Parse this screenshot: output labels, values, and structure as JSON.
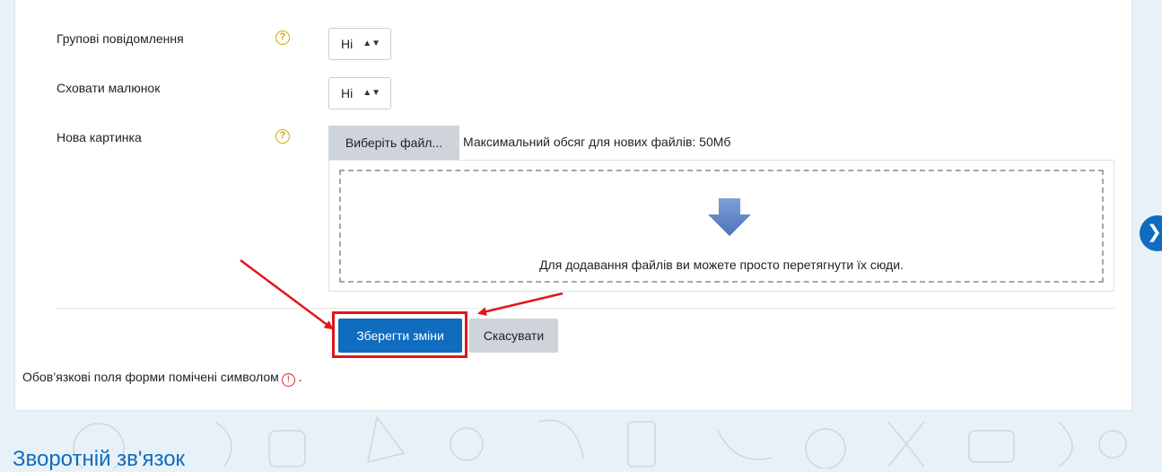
{
  "form": {
    "rows": [
      {
        "label": "Групові повідомлення",
        "value": "Ні",
        "has_help": true
      },
      {
        "label": "Сховати малюнок",
        "value": "Ні",
        "has_help": false
      },
      {
        "label": "Нова картинка",
        "has_help": true
      }
    ],
    "file_picker": {
      "button_label": "Виберіть файл...",
      "max_size_text": "Максимальний обсяг для нових файлів: 50Мб",
      "drop_text": "Для додавання файлів ви можете просто перетягнути їх сюди."
    },
    "buttons": {
      "save": "Зберегти зміни",
      "cancel": "Скасувати"
    },
    "required_note": "Обов’язкові поля форми помічені символом",
    "required_note_suffix": " ."
  },
  "footer": {
    "section_title": "Зворотній зв'язок"
  },
  "icons": {
    "help": "question-circle-icon",
    "required": "exclamation-circle-icon",
    "upload": "down-arrow-icon",
    "drawer": "chevron-right-icon"
  },
  "colors": {
    "primary": "#0f6cbf",
    "secondary_button": "#ced4da",
    "annotation": "#e0161c",
    "help_icon": "#d6a300",
    "required_icon": "#d9262c"
  }
}
